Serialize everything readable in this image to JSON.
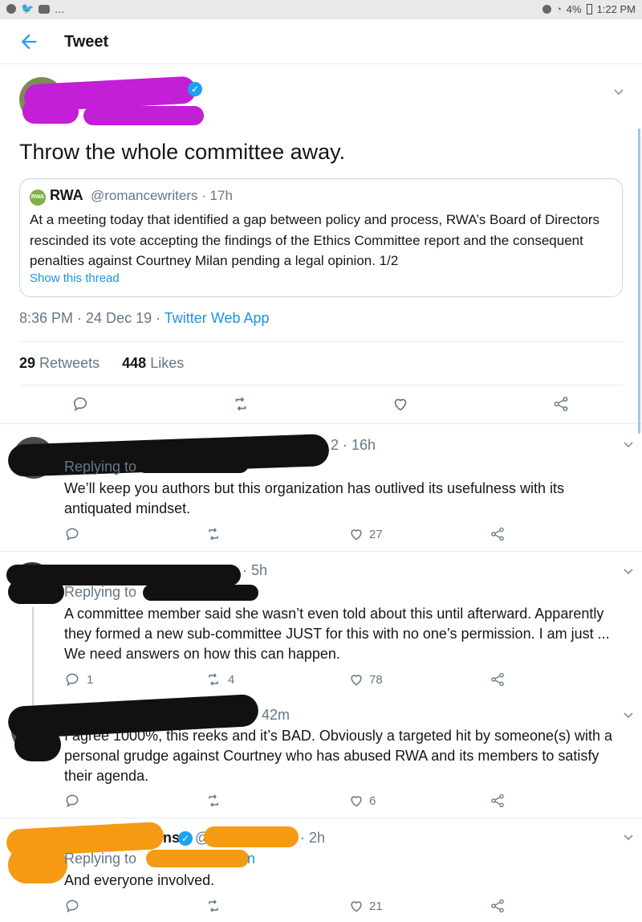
{
  "status_bar": {
    "left_extra": "...",
    "battery": "4%",
    "time": "1:22 PM"
  },
  "header": {
    "title": "Tweet"
  },
  "main_tweet": {
    "text": "Throw the whole committee away.",
    "quote": {
      "logo_text": "RWA",
      "name": "RWA",
      "handle_time": "@romancewriters · 17h",
      "text": "At a meeting today that identified a gap between policy and process, RWA’s Board of Directors rescinded its vote accepting the findings of the Ethics Committee report and the consequent penalties against Courtney Milan pending a legal opinion. 1/2",
      "link": "Show this thread"
    },
    "time_date": "8:36 PM · 24 Dec 19 · ",
    "source": "Twitter Web App",
    "retweets_count": "29",
    "retweets_label": "Retweets",
    "likes_count": "448",
    "likes_label": "Likes"
  },
  "replies": [
    {
      "time": "2 · 16h",
      "replying": "Replying to",
      "text": "We’ll keep you authors but this organization has outlived its usefulness with its antiquated mindset.",
      "reply_count": "",
      "retweet_count": "",
      "like_count": "27"
    },
    {
      "time": "· 5h",
      "replying": "Replying to",
      "text": "A committee member said she wasn’t even told about this until afterward. Apparently they formed a new sub-committee JUST for this with no one’s permission. I am just ... We need answers on how this can happen.",
      "reply_count": "1",
      "retweet_count": "4",
      "like_count": "78"
    },
    {
      "time": "42m",
      "replying": "",
      "text": "I agree 1000%, this reeks and it’s BAD. Obviously a targeted hit by someone(s) with a personal grudge against Courtney who has abused RWA and its members to satisfy their agenda.",
      "reply_count": "",
      "retweet_count": "",
      "like_count": "6"
    },
    {
      "time": "· 2h",
      "name_fragment": "ns",
      "handle_fragment": "@",
      "replying": "Replying to",
      "handle_tail": "n",
      "text": "And everyone involved.",
      "reply_count": "",
      "retweet_count": "",
      "like_count": "21"
    }
  ],
  "colors": {
    "accent": "#1da1f2",
    "link": "#1b95e0",
    "muted": "#657786",
    "redact_purple": "#c21fd6",
    "redact_black": "#111111",
    "redact_orange": "#f59a12"
  }
}
